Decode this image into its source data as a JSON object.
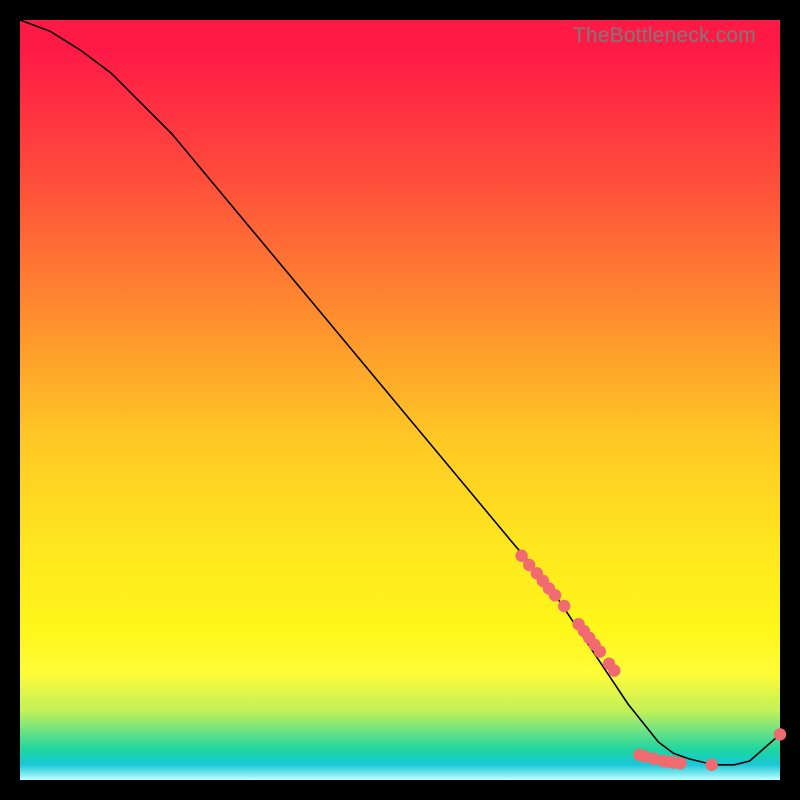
{
  "watermark": "TheBottleneck.com",
  "chart_data": {
    "type": "line",
    "title": "",
    "xlabel": "",
    "ylabel": "",
    "xlim": [
      0,
      100
    ],
    "ylim": [
      0,
      100
    ],
    "series": [
      {
        "name": "curve",
        "x": [
          0,
          4,
          8,
          12,
          20,
          30,
          40,
          50,
          60,
          65,
          68,
          70,
          72,
          74,
          76,
          78,
          80,
          82,
          84,
          86,
          88,
          90,
          92,
          94,
          96,
          100
        ],
        "y": [
          100,
          98.5,
          96,
          93,
          85,
          73,
          61,
          49,
          37,
          31,
          27.5,
          25,
          22,
          19,
          16,
          13,
          10,
          7.5,
          5,
          3.5,
          2.8,
          2.3,
          2.0,
          2.0,
          2.5,
          6
        ]
      }
    ],
    "markers": [
      {
        "x": 66,
        "y": 29.5
      },
      {
        "x": 67,
        "y": 28.3
      },
      {
        "x": 68,
        "y": 27.2
      },
      {
        "x": 68.8,
        "y": 26.2
      },
      {
        "x": 69.6,
        "y": 25.2
      },
      {
        "x": 70.4,
        "y": 24.3
      },
      {
        "x": 71.6,
        "y": 22.9
      },
      {
        "x": 73.5,
        "y": 20.5
      },
      {
        "x": 74.2,
        "y": 19.6
      },
      {
        "x": 74.9,
        "y": 18.7
      },
      {
        "x": 75.6,
        "y": 17.8
      },
      {
        "x": 76.3,
        "y": 16.9
      },
      {
        "x": 77.5,
        "y": 15.3
      },
      {
        "x": 78.2,
        "y": 14.4
      },
      {
        "x": 81.5,
        "y": 3.3
      },
      {
        "x": 82.2,
        "y": 3.1
      },
      {
        "x": 83.4,
        "y": 2.8
      },
      {
        "x": 84.6,
        "y": 2.5
      },
      {
        "x": 85.3,
        "y": 2.4
      },
      {
        "x": 86.0,
        "y": 2.3
      },
      {
        "x": 86.9,
        "y": 2.2
      },
      {
        "x": 91.0,
        "y": 2.0
      },
      {
        "x": 100.0,
        "y": 6.0
      }
    ],
    "marker_color": "#f16a6f",
    "line_color": "#000000"
  }
}
